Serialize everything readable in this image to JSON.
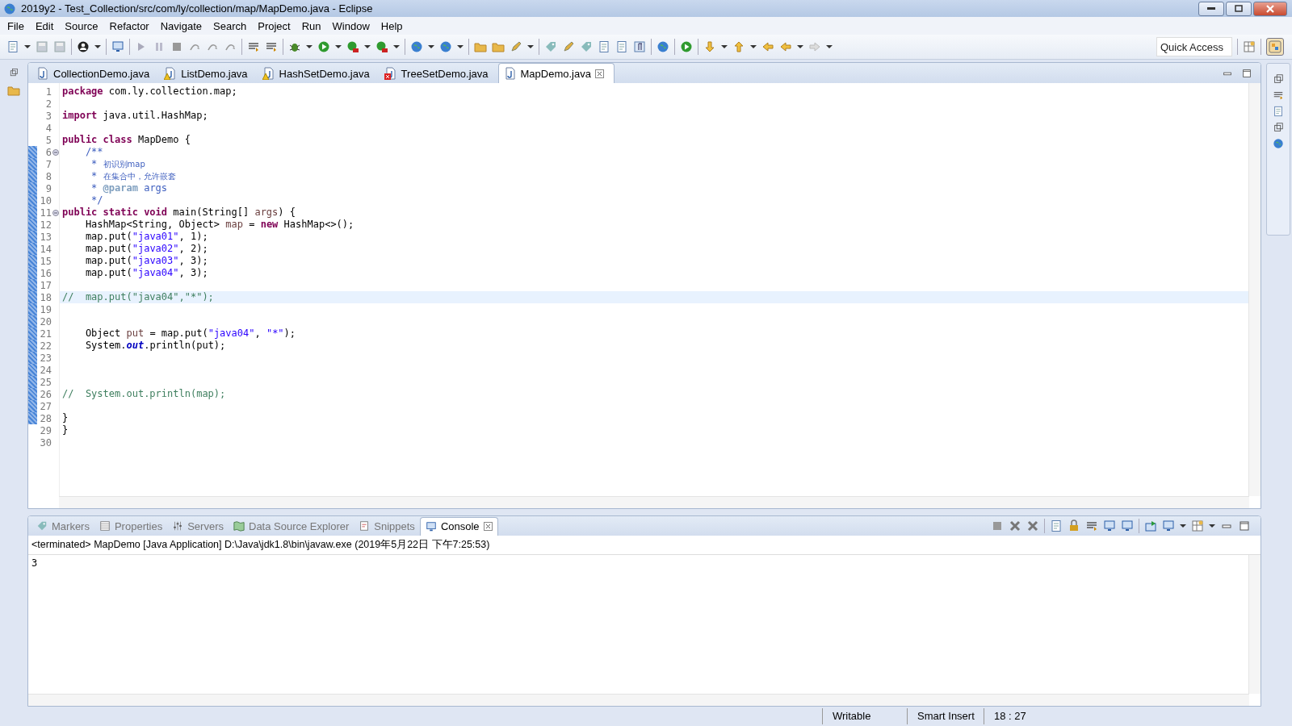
{
  "window": {
    "title": "2019y2 - Test_Collection/src/com/ly/collection/map/MapDemo.java - Eclipse"
  },
  "menu": [
    "File",
    "Edit",
    "Source",
    "Refactor",
    "Navigate",
    "Search",
    "Project",
    "Run",
    "Window",
    "Help"
  ],
  "quick_access": {
    "placeholder": "Quick Access"
  },
  "editor_tabs": [
    {
      "label": "CollectionDemo.java",
      "selected": false,
      "warning": false,
      "error": false
    },
    {
      "label": "ListDemo.java",
      "selected": false,
      "warning": true,
      "error": false
    },
    {
      "label": "HashSetDemo.java",
      "selected": false,
      "warning": true,
      "error": false
    },
    {
      "label": "TreeSetDemo.java",
      "selected": false,
      "warning": false,
      "error": true
    },
    {
      "label": "MapDemo.java",
      "selected": true,
      "warning": false,
      "error": false
    }
  ],
  "code_lines": [
    {
      "number": "1",
      "changed": false,
      "fold": false,
      "current": false,
      "tokens": [
        {
          "kind": "k",
          "text": "package"
        },
        {
          "kind": "p",
          "text": " com.ly.collection.map;"
        }
      ]
    },
    {
      "number": "2",
      "changed": false,
      "fold": false,
      "current": false
    },
    {
      "number": "3",
      "changed": false,
      "fold": false,
      "current": false,
      "tokens": [
        {
          "kind": "k",
          "text": "import"
        },
        {
          "kind": "p",
          "text": " java.util.HashMap;"
        }
      ]
    },
    {
      "number": "4",
      "changed": false,
      "fold": false,
      "current": false
    },
    {
      "number": "5",
      "changed": false,
      "fold": false,
      "current": false,
      "tokens": [
        {
          "kind": "k",
          "text": "public class"
        },
        {
          "kind": "p",
          "text": " MapDemo {"
        }
      ]
    },
    {
      "number": "6",
      "changed": true,
      "fold": true,
      "current": false,
      "tokens": [
        {
          "kind": "d",
          "text": "    /**"
        }
      ]
    },
    {
      "number": "7",
      "changed": true,
      "fold": false,
      "current": false,
      "tokens": [
        {
          "kind": "d",
          "text": "     * "
        },
        {
          "kind": "dc",
          "text": "初识别map"
        }
      ]
    },
    {
      "number": "8",
      "changed": true,
      "fold": false,
      "current": false,
      "tokens": [
        {
          "kind": "d",
          "text": "     * "
        },
        {
          "kind": "dc",
          "text": "在集合中，允许嵌套"
        }
      ]
    },
    {
      "number": "9",
      "changed": true,
      "fold": false,
      "current": false,
      "tokens": [
        {
          "kind": "d",
          "text": "     * "
        },
        {
          "kind": "t",
          "text": "@param"
        },
        {
          "kind": "d",
          "text": " args"
        }
      ]
    },
    {
      "number": "10",
      "changed": true,
      "fold": false,
      "current": false,
      "tokens": [
        {
          "kind": "d",
          "text": "     */"
        }
      ]
    },
    {
      "number": "11",
      "changed": true,
      "fold": true,
      "current": false,
      "tokens": [
        {
          "kind": "k",
          "text": "public static void"
        },
        {
          "kind": "p",
          "text": " main(String[] "
        },
        {
          "kind": "v",
          "text": "args"
        },
        {
          "kind": "p",
          "text": ") {"
        }
      ]
    },
    {
      "number": "12",
      "changed": true,
      "fold": false,
      "current": false,
      "tokens": [
        {
          "kind": "p",
          "text": "    HashMap<String, Object> "
        },
        {
          "kind": "v",
          "text": "map"
        },
        {
          "kind": "p",
          "text": " = "
        },
        {
          "kind": "k",
          "text": "new"
        },
        {
          "kind": "p",
          "text": " HashMap<>();"
        }
      ]
    },
    {
      "number": "13",
      "changed": true,
      "fold": false,
      "current": false,
      "tokens": [
        {
          "kind": "p",
          "text": "    map.put("
        },
        {
          "kind": "s",
          "text": "\"java01\""
        },
        {
          "kind": "p",
          "text": ", 1);"
        }
      ]
    },
    {
      "number": "14",
      "changed": true,
      "fold": false,
      "current": false,
      "tokens": [
        {
          "kind": "p",
          "text": "    map.put("
        },
        {
          "kind": "s",
          "text": "\"java02\""
        },
        {
          "kind": "p",
          "text": ", 2);"
        }
      ]
    },
    {
      "number": "15",
      "changed": true,
      "fold": false,
      "current": false,
      "tokens": [
        {
          "kind": "p",
          "text": "    map.put("
        },
        {
          "kind": "s",
          "text": "\"java03\""
        },
        {
          "kind": "p",
          "text": ", 3);"
        }
      ]
    },
    {
      "number": "16",
      "changed": true,
      "fold": false,
      "current": false,
      "tokens": [
        {
          "kind": "p",
          "text": "    map.put("
        },
        {
          "kind": "s",
          "text": "\"java04\""
        },
        {
          "kind": "p",
          "text": ", 3);"
        }
      ]
    },
    {
      "number": "17",
      "changed": true,
      "fold": false,
      "current": false
    },
    {
      "number": "18",
      "changed": true,
      "fold": false,
      "current": true,
      "tokens": [
        {
          "kind": "c",
          "text": "//  map.put(\"java04\",\"*\");"
        }
      ]
    },
    {
      "number": "19",
      "changed": true,
      "fold": false,
      "current": false
    },
    {
      "number": "20",
      "changed": true,
      "fold": false,
      "current": false
    },
    {
      "number": "21",
      "changed": true,
      "fold": false,
      "current": false,
      "tokens": [
        {
          "kind": "p",
          "text": "    Object "
        },
        {
          "kind": "v",
          "text": "put"
        },
        {
          "kind": "p",
          "text": " = map.put("
        },
        {
          "kind": "s",
          "text": "\"java04\""
        },
        {
          "kind": "p",
          "text": ", "
        },
        {
          "kind": "s",
          "text": "\"*\""
        },
        {
          "kind": "p",
          "text": ");"
        }
      ]
    },
    {
      "number": "22",
      "changed": true,
      "fold": false,
      "current": false,
      "tokens": [
        {
          "kind": "p",
          "text": "    System."
        },
        {
          "kind": "f",
          "text": "out"
        },
        {
          "kind": "p",
          "text": ".println(put);"
        }
      ]
    },
    {
      "number": "23",
      "changed": true,
      "fold": false,
      "current": false
    },
    {
      "number": "24",
      "changed": true,
      "fold": false,
      "current": false
    },
    {
      "number": "25",
      "changed": true,
      "fold": false,
      "current": false
    },
    {
      "number": "26",
      "changed": true,
      "fold": false,
      "current": false,
      "tokens": [
        {
          "kind": "c",
          "text": "//  System.out.println(map);"
        }
      ]
    },
    {
      "number": "27",
      "changed": true,
      "fold": false,
      "current": false
    },
    {
      "number": "28",
      "changed": true,
      "fold": false,
      "current": false,
      "tokens": [
        {
          "kind": "p",
          "text": "}"
        }
      ]
    },
    {
      "number": "29",
      "changed": false,
      "fold": false,
      "current": false,
      "tokens": [
        {
          "kind": "p",
          "text": "}"
        }
      ]
    },
    {
      "number": "30",
      "changed": false,
      "fold": false,
      "current": false
    }
  ],
  "panel_tabs": [
    {
      "label": "Markers",
      "selected": false
    },
    {
      "label": "Properties",
      "selected": false
    },
    {
      "label": "Servers",
      "selected": false
    },
    {
      "label": "Data Source Explorer",
      "selected": false
    },
    {
      "label": "Snippets",
      "selected": false
    },
    {
      "label": "Console",
      "selected": true
    }
  ],
  "console": {
    "header": "<terminated> MapDemo [Java Application] D:\\Java\\jdk1.8\\bin\\javaw.exe (2019年5月22日 下午7:25:53)",
    "output": [
      "3"
    ]
  },
  "status_bar": [
    "Writable",
    "Smart Insert",
    "18 : 27"
  ]
}
